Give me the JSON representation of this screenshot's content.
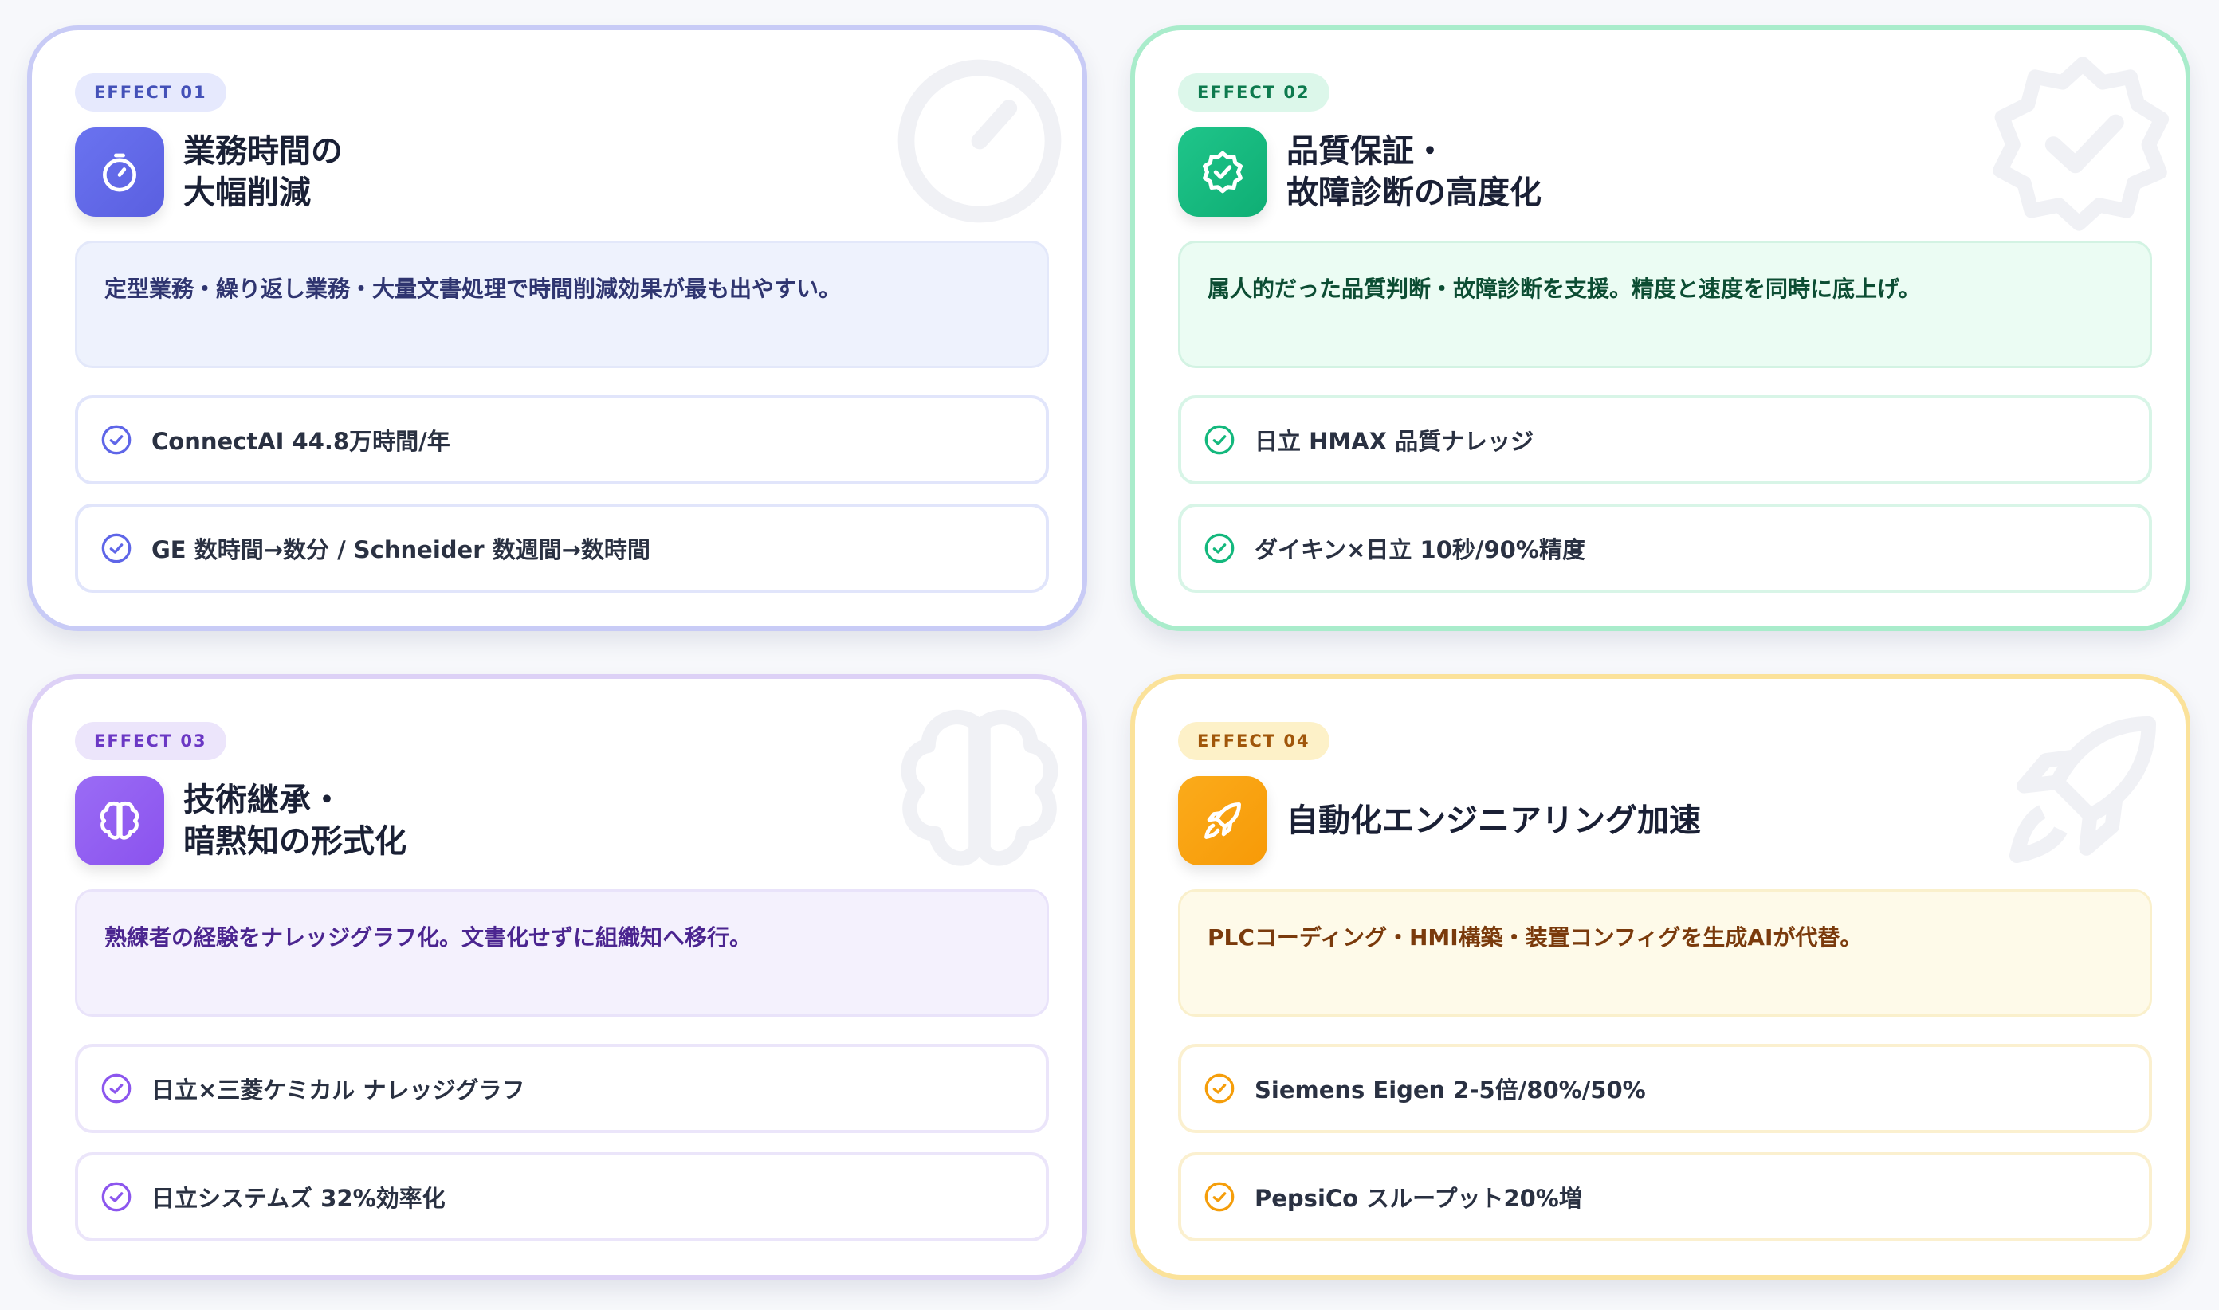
{
  "cards": [
    {
      "badge": "EFFECT 01",
      "title": "業務時間の\n大幅削減",
      "head_icon": "stopwatch-icon",
      "accent": "#5f66e8",
      "description": "定型業務・繰り返し業務・大量文書処理で時間削減効果が最も出やすい。",
      "items": [
        "ConnectAI 44.8万時間/年",
        "GE 数時間→数分 / Schneider 数週間→数時間"
      ]
    },
    {
      "badge": "EFFECT 02",
      "title": "品質保証・\n故障診断の高度化",
      "head_icon": "badge-check-icon",
      "accent": "#14b87d",
      "description": "属人的だった品質判断・故障診断を支援。精度と速度を同時に底上げ。",
      "items": [
        "日立 HMAX 品質ナレッジ",
        "ダイキン×日立 10秒/90%精度"
      ]
    },
    {
      "badge": "EFFECT 03",
      "title": "技術継承・\n暗黙知の形式化",
      "head_icon": "brain-icon",
      "accent": "#8c56ee",
      "description": "熟練者の経験をナレッジグラフ化。文書化せずに組織知へ移行。",
      "items": [
        "日立×三菱ケミカル ナレッジグラフ",
        "日立システムズ 32%効率化"
      ]
    },
    {
      "badge": "EFFECT 04",
      "title": "自動化エンジニアリング加速",
      "head_icon": "rocket-icon",
      "accent": "#f59e0b",
      "description": "PLCコーディング・HMI構築・装置コンフィグを生成AIが代替。",
      "items": [
        "Siemens Eigen 2-5倍/80%/50%",
        "PepsiCo スループット20%増"
      ]
    }
  ]
}
